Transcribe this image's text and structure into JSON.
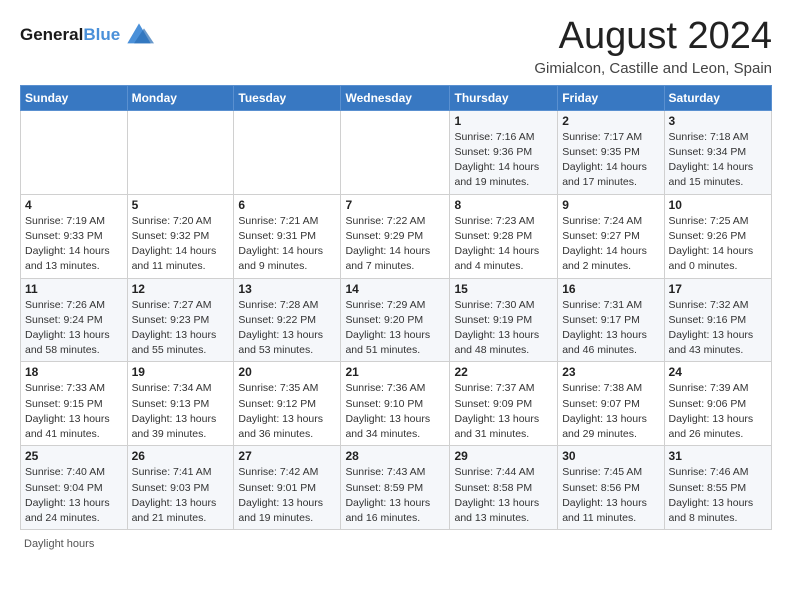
{
  "header": {
    "logo_line1": "General",
    "logo_line2": "Blue",
    "main_title": "August 2024",
    "subtitle": "Gimialcon, Castille and Leon, Spain"
  },
  "weekdays": [
    "Sunday",
    "Monday",
    "Tuesday",
    "Wednesday",
    "Thursday",
    "Friday",
    "Saturday"
  ],
  "weeks": [
    [
      {
        "num": "",
        "info": ""
      },
      {
        "num": "",
        "info": ""
      },
      {
        "num": "",
        "info": ""
      },
      {
        "num": "",
        "info": ""
      },
      {
        "num": "1",
        "info": "Sunrise: 7:16 AM\nSunset: 9:36 PM\nDaylight: 14 hours\nand 19 minutes."
      },
      {
        "num": "2",
        "info": "Sunrise: 7:17 AM\nSunset: 9:35 PM\nDaylight: 14 hours\nand 17 minutes."
      },
      {
        "num": "3",
        "info": "Sunrise: 7:18 AM\nSunset: 9:34 PM\nDaylight: 14 hours\nand 15 minutes."
      }
    ],
    [
      {
        "num": "4",
        "info": "Sunrise: 7:19 AM\nSunset: 9:33 PM\nDaylight: 14 hours\nand 13 minutes."
      },
      {
        "num": "5",
        "info": "Sunrise: 7:20 AM\nSunset: 9:32 PM\nDaylight: 14 hours\nand 11 minutes."
      },
      {
        "num": "6",
        "info": "Sunrise: 7:21 AM\nSunset: 9:31 PM\nDaylight: 14 hours\nand 9 minutes."
      },
      {
        "num": "7",
        "info": "Sunrise: 7:22 AM\nSunset: 9:29 PM\nDaylight: 14 hours\nand 7 minutes."
      },
      {
        "num": "8",
        "info": "Sunrise: 7:23 AM\nSunset: 9:28 PM\nDaylight: 14 hours\nand 4 minutes."
      },
      {
        "num": "9",
        "info": "Sunrise: 7:24 AM\nSunset: 9:27 PM\nDaylight: 14 hours\nand 2 minutes."
      },
      {
        "num": "10",
        "info": "Sunrise: 7:25 AM\nSunset: 9:26 PM\nDaylight: 14 hours\nand 0 minutes."
      }
    ],
    [
      {
        "num": "11",
        "info": "Sunrise: 7:26 AM\nSunset: 9:24 PM\nDaylight: 13 hours\nand 58 minutes."
      },
      {
        "num": "12",
        "info": "Sunrise: 7:27 AM\nSunset: 9:23 PM\nDaylight: 13 hours\nand 55 minutes."
      },
      {
        "num": "13",
        "info": "Sunrise: 7:28 AM\nSunset: 9:22 PM\nDaylight: 13 hours\nand 53 minutes."
      },
      {
        "num": "14",
        "info": "Sunrise: 7:29 AM\nSunset: 9:20 PM\nDaylight: 13 hours\nand 51 minutes."
      },
      {
        "num": "15",
        "info": "Sunrise: 7:30 AM\nSunset: 9:19 PM\nDaylight: 13 hours\nand 48 minutes."
      },
      {
        "num": "16",
        "info": "Sunrise: 7:31 AM\nSunset: 9:17 PM\nDaylight: 13 hours\nand 46 minutes."
      },
      {
        "num": "17",
        "info": "Sunrise: 7:32 AM\nSunset: 9:16 PM\nDaylight: 13 hours\nand 43 minutes."
      }
    ],
    [
      {
        "num": "18",
        "info": "Sunrise: 7:33 AM\nSunset: 9:15 PM\nDaylight: 13 hours\nand 41 minutes."
      },
      {
        "num": "19",
        "info": "Sunrise: 7:34 AM\nSunset: 9:13 PM\nDaylight: 13 hours\nand 39 minutes."
      },
      {
        "num": "20",
        "info": "Sunrise: 7:35 AM\nSunset: 9:12 PM\nDaylight: 13 hours\nand 36 minutes."
      },
      {
        "num": "21",
        "info": "Sunrise: 7:36 AM\nSunset: 9:10 PM\nDaylight: 13 hours\nand 34 minutes."
      },
      {
        "num": "22",
        "info": "Sunrise: 7:37 AM\nSunset: 9:09 PM\nDaylight: 13 hours\nand 31 minutes."
      },
      {
        "num": "23",
        "info": "Sunrise: 7:38 AM\nSunset: 9:07 PM\nDaylight: 13 hours\nand 29 minutes."
      },
      {
        "num": "24",
        "info": "Sunrise: 7:39 AM\nSunset: 9:06 PM\nDaylight: 13 hours\nand 26 minutes."
      }
    ],
    [
      {
        "num": "25",
        "info": "Sunrise: 7:40 AM\nSunset: 9:04 PM\nDaylight: 13 hours\nand 24 minutes."
      },
      {
        "num": "26",
        "info": "Sunrise: 7:41 AM\nSunset: 9:03 PM\nDaylight: 13 hours\nand 21 minutes."
      },
      {
        "num": "27",
        "info": "Sunrise: 7:42 AM\nSunset: 9:01 PM\nDaylight: 13 hours\nand 19 minutes."
      },
      {
        "num": "28",
        "info": "Sunrise: 7:43 AM\nSunset: 8:59 PM\nDaylight: 13 hours\nand 16 minutes."
      },
      {
        "num": "29",
        "info": "Sunrise: 7:44 AM\nSunset: 8:58 PM\nDaylight: 13 hours\nand 13 minutes."
      },
      {
        "num": "30",
        "info": "Sunrise: 7:45 AM\nSunset: 8:56 PM\nDaylight: 13 hours\nand 11 minutes."
      },
      {
        "num": "31",
        "info": "Sunrise: 7:46 AM\nSunset: 8:55 PM\nDaylight: 13 hours\nand 8 minutes."
      }
    ]
  ],
  "footer": {
    "daylight_label": "Daylight hours"
  }
}
